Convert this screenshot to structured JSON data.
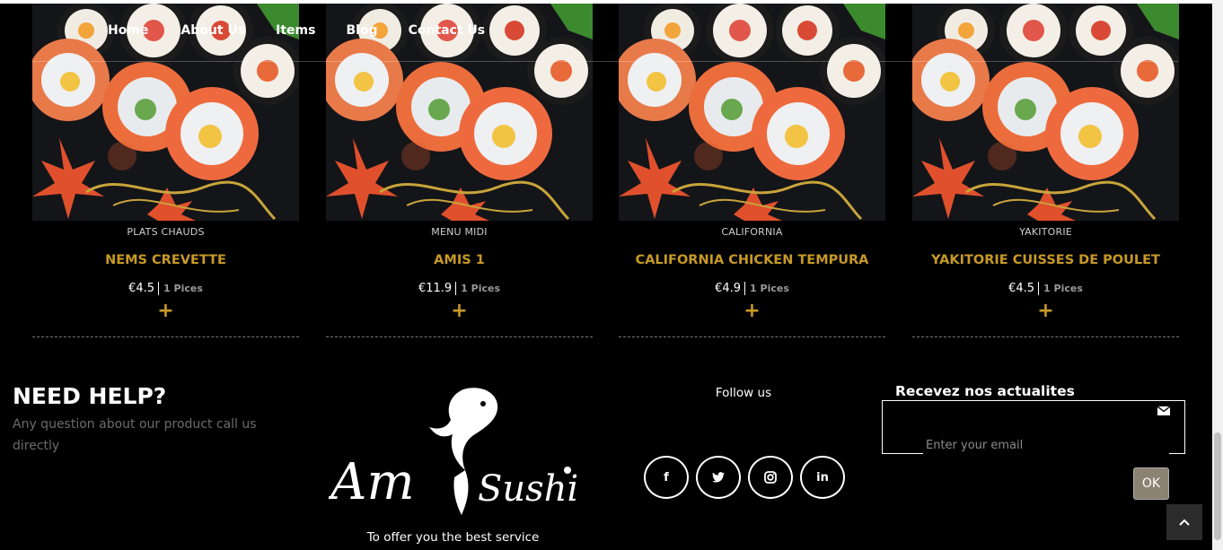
{
  "nav": {
    "items": [
      "Home",
      "About Us",
      "Items",
      "Blog",
      "Contact Us"
    ]
  },
  "products": [
    {
      "category": "PLATS CHAUDS",
      "name": "NEMS CREVETTE",
      "price": "€4.5",
      "pieces": "1 Pices",
      "add": "+"
    },
    {
      "category": "MENU MIDI",
      "name": "AMIS 1",
      "price": "€11.9",
      "pieces": "1 Pices",
      "add": "+"
    },
    {
      "category": "CALIFORNIA",
      "name": "CALIFORNIA CHICKEN TEMPURA",
      "price": "€4.9",
      "pieces": "1 Pices",
      "add": "+"
    },
    {
      "category": "YAKITORIE",
      "name": "YAKITORIE CUISSES DE POULET",
      "price": "€4.5",
      "pieces": "1 Pices",
      "add": "+"
    }
  ],
  "footer": {
    "help_title": "NEED HELP?",
    "help_text": "Any question about our product call us directly",
    "logo_text": "Amis Sushi",
    "tagline": "To offer you the best service",
    "follow_label": "Follow us",
    "socials": [
      {
        "icon": "facebook-icon",
        "glyph": "f"
      },
      {
        "icon": "twitter-icon",
        "glyph": "t"
      },
      {
        "icon": "instagram-icon",
        "glyph": "◎"
      },
      {
        "icon": "linkedin-icon",
        "glyph": "in"
      }
    ],
    "newsletter_title": "Recevez nos actualites",
    "email_placeholder": "Enter your email",
    "ok_label": "OK"
  },
  "colors": {
    "accent": "#c79a26",
    "background": "#000000",
    "muted_text": "#6b6b6b"
  }
}
